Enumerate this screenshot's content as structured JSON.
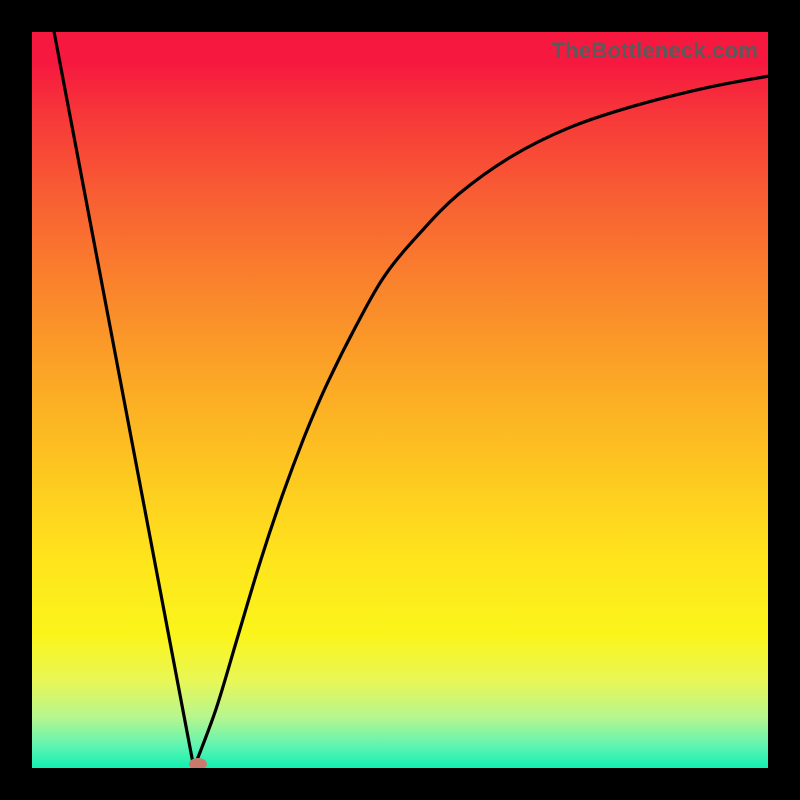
{
  "watermark": "TheBottleneck.com",
  "chart_data": {
    "type": "line",
    "title": "",
    "xlabel": "",
    "ylabel": "",
    "xlim": [
      0,
      100
    ],
    "ylim": [
      0,
      100
    ],
    "series": [
      {
        "name": "left-segment",
        "x": [
          3,
          22
        ],
        "y": [
          100,
          0
        ]
      },
      {
        "name": "right-segment",
        "x": [
          22,
          25,
          28,
          31,
          34,
          37,
          40,
          44,
          48,
          53,
          58,
          65,
          73,
          82,
          92,
          100
        ],
        "y": [
          0,
          8,
          18,
          28,
          37,
          45,
          52,
          60,
          67,
          73,
          78,
          83,
          87,
          90,
          92.5,
          94
        ]
      }
    ],
    "marker": {
      "x": 22.5,
      "y": 0.5
    },
    "colors": {
      "curve": "#000000",
      "marker": "#c87b6d",
      "gradient_top": "#f6183f",
      "gradient_bottom": "#11f0b1"
    }
  }
}
